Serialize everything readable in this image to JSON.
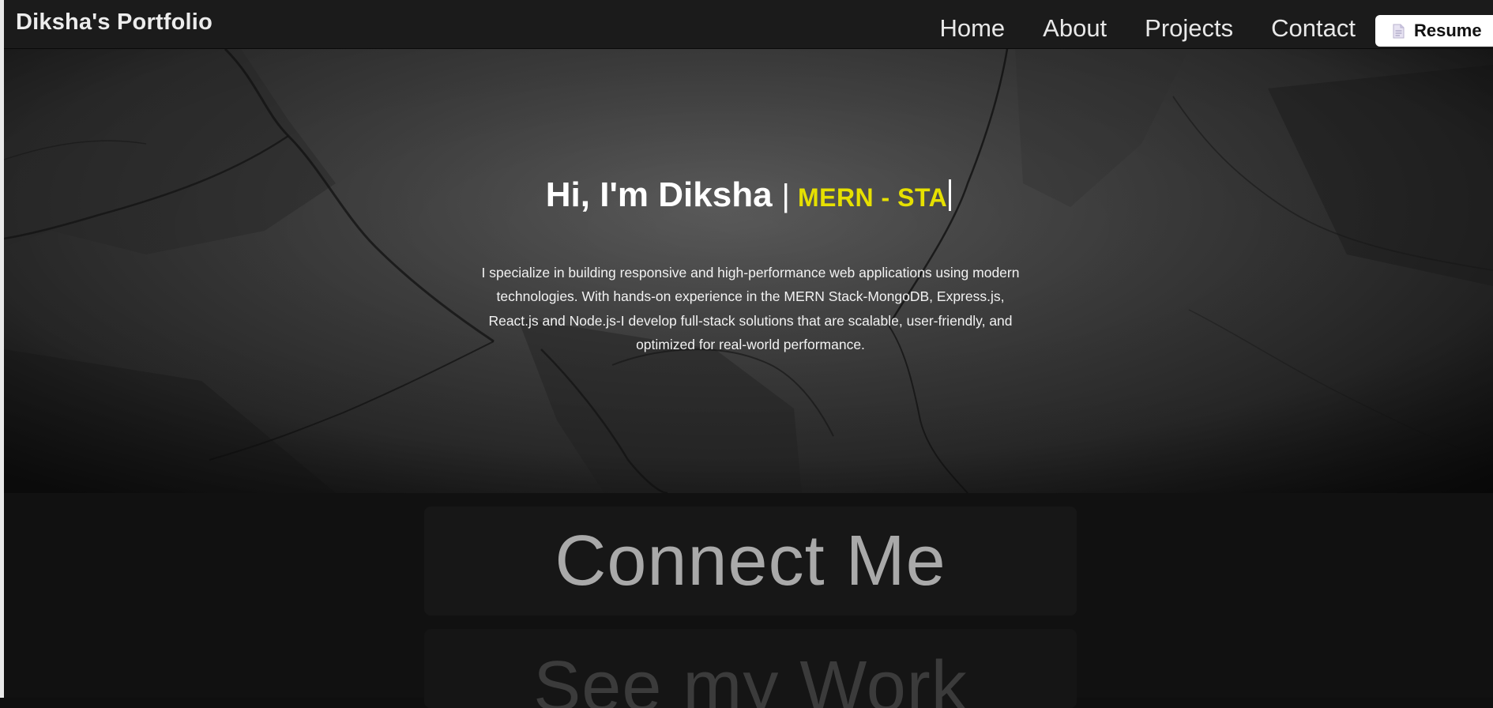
{
  "navbar": {
    "brand": "Diksha's Portfolio",
    "links": [
      "Home",
      "About",
      "Projects",
      "Contact"
    ],
    "resume_label": "Resume",
    "resume_icon": "document-icon"
  },
  "hero": {
    "greeting": "Hi, I'm Diksha",
    "separator": "|",
    "typed_role": "MERN - STA",
    "bio": "I specialize in building responsive and high-performance web applications using modern technologies. With hands-on experience in the MERN Stack-MongoDB, Express.js, React.js and Node.js-I develop full-stack solutions that are scalable, user-friendly, and optimized for real-world performance."
  },
  "actions": {
    "connect_label": "Connect Me",
    "work_label": "See my Work"
  },
  "colors": {
    "accent_yellow": "#e6e000",
    "navbar_bg": "#1b1b1b",
    "page_bg": "#111111"
  }
}
